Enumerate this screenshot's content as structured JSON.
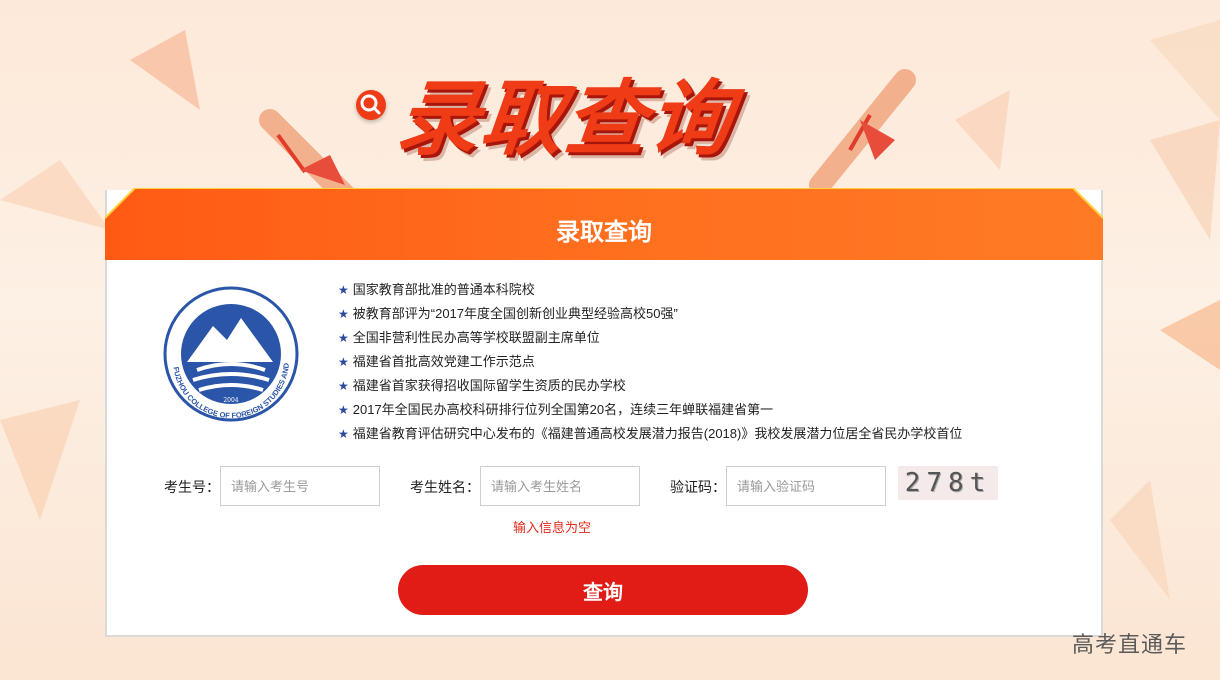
{
  "banner": {
    "title": "录取查询"
  },
  "panel": {
    "title": "录取查询"
  },
  "school": {
    "logo_text": "FUZHOU COLLEGE OF FOREIGN STUDIES AND TRADE",
    "logo_year": "2004"
  },
  "features": [
    "国家教育部批准的普通本科院校",
    "被教育部评为“2017年度全国创新创业典型经验高校50强”",
    "全国非营利性民办高等学校联盟副主席单位",
    "福建省首批高效党建工作示范点",
    "福建省首家获得招收国际留学生资质的民办学校",
    "2017年全国民办高校科研排行位列全国第20名，连续三年蝉联福建省第一",
    "福建省教育评估研究中心发布的《福建普通高校发展潜力报告(2018)》我校发展潜力位居全省民办学校首位"
  ],
  "form": {
    "exam_no": {
      "label": "考生号：",
      "placeholder": "请输入考生号"
    },
    "name": {
      "label": "考生姓名：",
      "placeholder": "请输入考生姓名"
    },
    "captcha": {
      "label": "验证码：",
      "placeholder": "请输入验证码",
      "image_text": "278t"
    },
    "error": "输入信息为空",
    "submit_label": "查询"
  },
  "watermark": "高考直通车",
  "colors": {
    "accent": "#e11b16",
    "header_orange": "#ff6a1a",
    "star_blue": "#2a4b9a"
  }
}
